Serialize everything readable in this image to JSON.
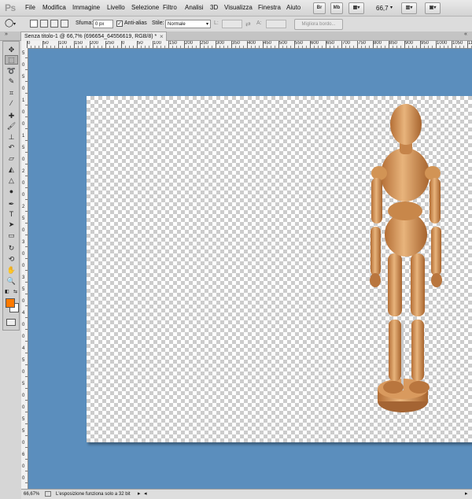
{
  "app": {
    "logo": "Ps"
  },
  "menu": [
    "File",
    "Modifica",
    "Immagine",
    "Livello",
    "Selezione",
    "Filtro",
    "Analisi",
    "3D",
    "Visualizza",
    "Finestra",
    "Aiuto"
  ],
  "appbar": {
    "bridge": "Br",
    "minibridge": "Mb",
    "zoom": "66,7"
  },
  "options": {
    "feather_label": "Sfuma:",
    "feather_value": "0 px",
    "antialias_label": "Anti-alias",
    "antialias_checked": true,
    "style_label": "Stile:",
    "style_value": "Normale",
    "width_label": "L:",
    "height_label": "A:",
    "refine_edge_label": "Migliora bordo..."
  },
  "document_tab": {
    "title": "Senza titolo-1 @ 66,7% (696654_64556619, RGB/8) *"
  },
  "rulers": {
    "top_labels": [
      "0",
      "50",
      "100",
      "150",
      "200",
      "250",
      "0",
      "50",
      "100",
      "150",
      "200",
      "250",
      "300",
      "350",
      "400",
      "450",
      "500",
      "550",
      "600",
      "650",
      "700",
      "750",
      "800",
      "850",
      "900",
      "950",
      "1000",
      "1050",
      "1100"
    ],
    "left_labels": [
      "5",
      "0",
      "5",
      "0",
      "1",
      "0",
      "0",
      "1",
      "5",
      "0",
      "2",
      "0",
      "0",
      "2",
      "5",
      "0",
      "3",
      "0",
      "0",
      "3",
      "5",
      "0",
      "4",
      "0",
      "0",
      "4",
      "5",
      "0",
      "5",
      "0",
      "0",
      "5",
      "5",
      "0",
      "6",
      "0",
      "0"
    ]
  },
  "status": {
    "zoom": "66,67%",
    "message": "L'esposizione funziona solo a 32 bit"
  },
  "colors": {
    "workspace": "#5b8ebd",
    "foreground_swatch": "#ff7a00",
    "background_swatch": "#ffffff"
  },
  "tools": [
    "move-icon",
    "rect-marquee-icon",
    "lasso-icon",
    "quick-select-icon",
    "crop-icon",
    "eyedropper-icon",
    "healing-brush-icon",
    "brush-icon",
    "clone-stamp-icon",
    "history-brush-icon",
    "eraser-icon",
    "paint-bucket-icon",
    "blur-icon",
    "dodge-icon",
    "pen-icon",
    "type-icon",
    "path-select-icon",
    "shape-icon",
    "3d-rotate-icon",
    "3d-orbit-icon",
    "hand-icon",
    "zoom-icon"
  ]
}
